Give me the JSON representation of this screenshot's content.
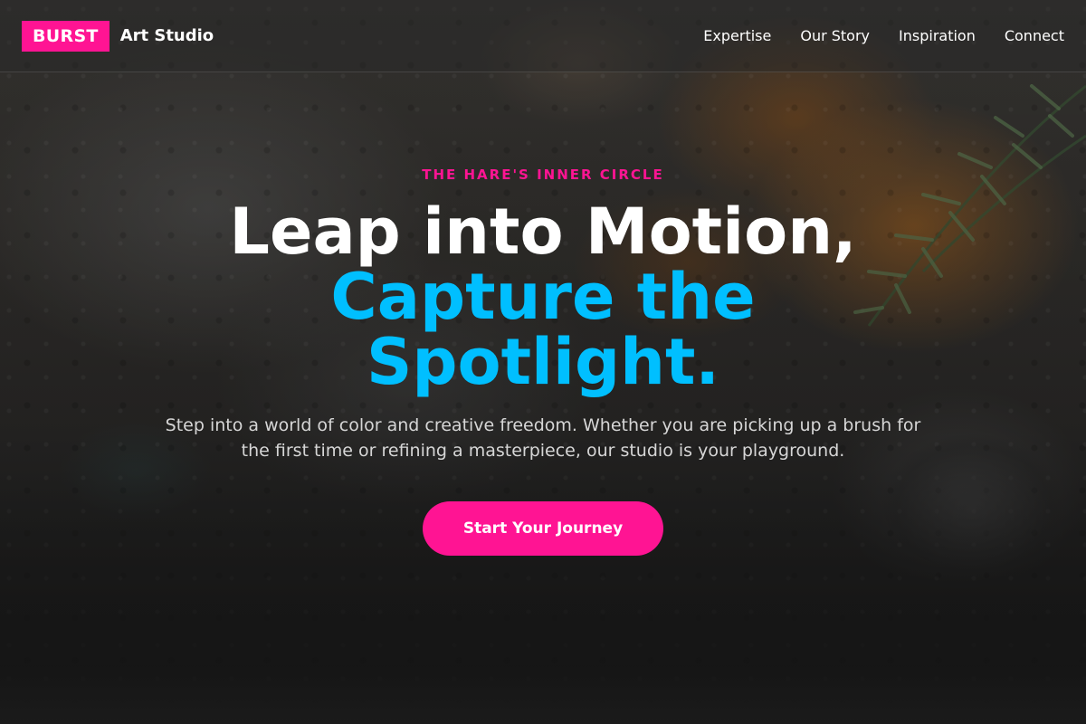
{
  "nav": {
    "brand_badge": "BURST",
    "brand_name": "Art Studio",
    "links": [
      {
        "label": "Expertise"
      },
      {
        "label": "Our Story"
      },
      {
        "label": "Inspiration"
      },
      {
        "label": "Connect"
      }
    ]
  },
  "hero": {
    "eyebrow": "THE HARE'S INNER CIRCLE",
    "headline_line1": "Leap into Motion,",
    "headline_accent": "Capture the Spotlight.",
    "lead": "Step into a world of color and creative freedom. Whether you are picking up a brush for the first time or refining a masterpiece, our studio is your playground.",
    "cta_label": "Start Your Journey"
  },
  "colors": {
    "accent_pink": "#ff1493",
    "accent_blue": "#00bfff",
    "text_white": "#ffffff"
  }
}
